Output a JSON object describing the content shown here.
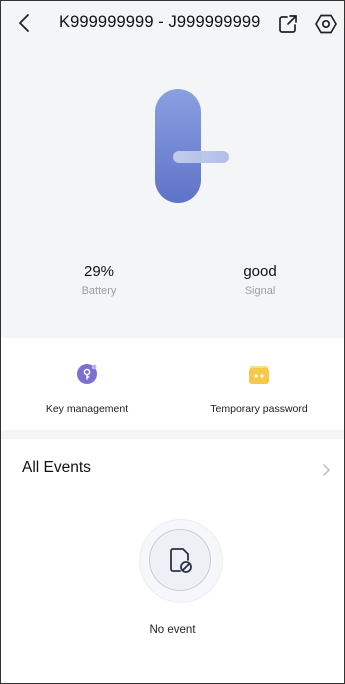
{
  "header": {
    "title": "K999999999 - J999999999",
    "back_icon": "chevron-left-icon",
    "share_icon": "external-link-icon",
    "settings_icon": "hexagon-settings-icon"
  },
  "lock": {
    "illustration": "smart-lock-icon",
    "battery": {
      "value": "29%",
      "label": "Battery"
    },
    "signal": {
      "value": "good",
      "label": "Signal"
    }
  },
  "actions": [
    {
      "label": "Key management",
      "icon": "key-icon",
      "color": "#7b6fd0"
    },
    {
      "label": "Temporary password",
      "icon": "password-card-icon",
      "color": "#f7c948"
    }
  ],
  "events": {
    "title": "All Events",
    "chevron_icon": "chevron-right-icon",
    "empty_icon": "file-blocked-icon",
    "empty_label": "No event"
  },
  "colors": {
    "background": "#f4f5f7",
    "lock_body": "#6f86d4",
    "accent_purple": "#7b6fd0",
    "accent_yellow": "#f7c948",
    "muted_text": "#9a9ea6"
  }
}
